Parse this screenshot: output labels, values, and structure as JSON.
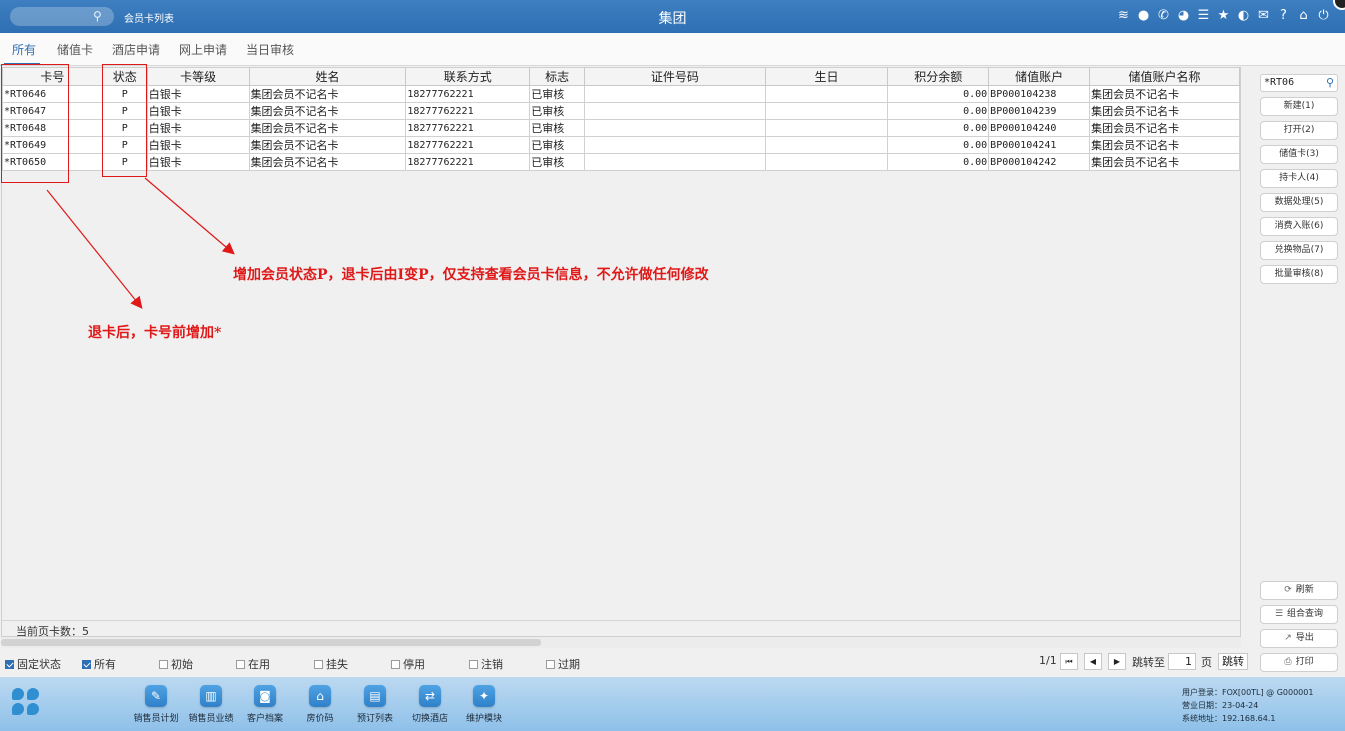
{
  "topbar": {
    "breadcrumb": "会员卡列表",
    "title": "集团",
    "icons": [
      "wifi-icon",
      "chat-icon",
      "phone-icon",
      "palette-icon",
      "menu-icon",
      "star-icon",
      "theme-icon",
      "mail-icon",
      "help-icon",
      "home-icon",
      "power-icon"
    ]
  },
  "tabs": [
    "所有",
    "储值卡",
    "酒店申请",
    "网上申请",
    "当日审核"
  ],
  "grid": {
    "columns": [
      "卡号",
      "状态",
      "卡等级",
      "姓名",
      "联系方式",
      "标志",
      "证件号码",
      "生日",
      "积分余额",
      "储值账户",
      "储值账户名称"
    ],
    "rows": [
      [
        "*RT0646",
        "P",
        "白银卡",
        "集团会员不记名卡",
        "18277762221",
        "已审核",
        "",
        "",
        "0.00",
        "BP000104238",
        "集团会员不记名卡"
      ],
      [
        "*RT0647",
        "P",
        "白银卡",
        "集团会员不记名卡",
        "18277762221",
        "已审核",
        "",
        "",
        "0.00",
        "BP000104239",
        "集团会员不记名卡"
      ],
      [
        "*RT0648",
        "P",
        "白银卡",
        "集团会员不记名卡",
        "18277762221",
        "已审核",
        "",
        "",
        "0.00",
        "BP000104240",
        "集团会员不记名卡"
      ],
      [
        "*RT0649",
        "P",
        "白银卡",
        "集团会员不记名卡",
        "18277762221",
        "已审核",
        "",
        "",
        "0.00",
        "BP000104241",
        "集团会员不记名卡"
      ],
      [
        "*RT0650",
        "P",
        "白银卡",
        "集团会员不记名卡",
        "18277762221",
        "已审核",
        "",
        "",
        "0.00",
        "BP000104242",
        "集团会员不记名卡"
      ]
    ],
    "footer_count": "当前页卡数：5"
  },
  "annotations": {
    "note_status": "增加会员状态P，退卡后由I变P，仅支持查看会员卡信息，不允许做任何修改",
    "note_card": "退卡后，卡号前增加*",
    "color": "#e01818"
  },
  "filters": {
    "items": [
      {
        "label": "固定状态",
        "checked": true
      },
      {
        "label": "所有",
        "checked": true
      },
      {
        "label": "初始",
        "checked": false
      },
      {
        "label": "在用",
        "checked": false
      },
      {
        "label": "挂失",
        "checked": false
      },
      {
        "label": "停用",
        "checked": false
      },
      {
        "label": "注销",
        "checked": false
      },
      {
        "label": "过期",
        "checked": false
      }
    ]
  },
  "pager": {
    "page": "1/1",
    "goto_label": "跳转至",
    "page_value": "1",
    "page_unit": "页",
    "jump_label": "跳转"
  },
  "right_panel": {
    "search_value": "*RT06",
    "buttons": [
      "新建(1)",
      "打开(2)",
      "储值卡(3)",
      "持卡人(4)",
      "数据处理(5)",
      "消费入账(6)",
      "兑换物品(7)",
      "批量审核(8)"
    ],
    "bottom_buttons": [
      "刷新",
      "组合查询",
      "导出",
      "打印"
    ]
  },
  "dock": {
    "items": [
      "销售员计划",
      "销售员业绩",
      "客户档案",
      "房价码",
      "预订列表",
      "切换酒店",
      "维护模块"
    ]
  },
  "sysinfo": {
    "user": "用户登录：FOX[00TL] @ G000001",
    "date": "营业日期：23-04-24",
    "addr": "系统地址：192.168.64.1"
  },
  "colors": {
    "accent": "#2f6fb3",
    "annotation": "#e01818"
  }
}
